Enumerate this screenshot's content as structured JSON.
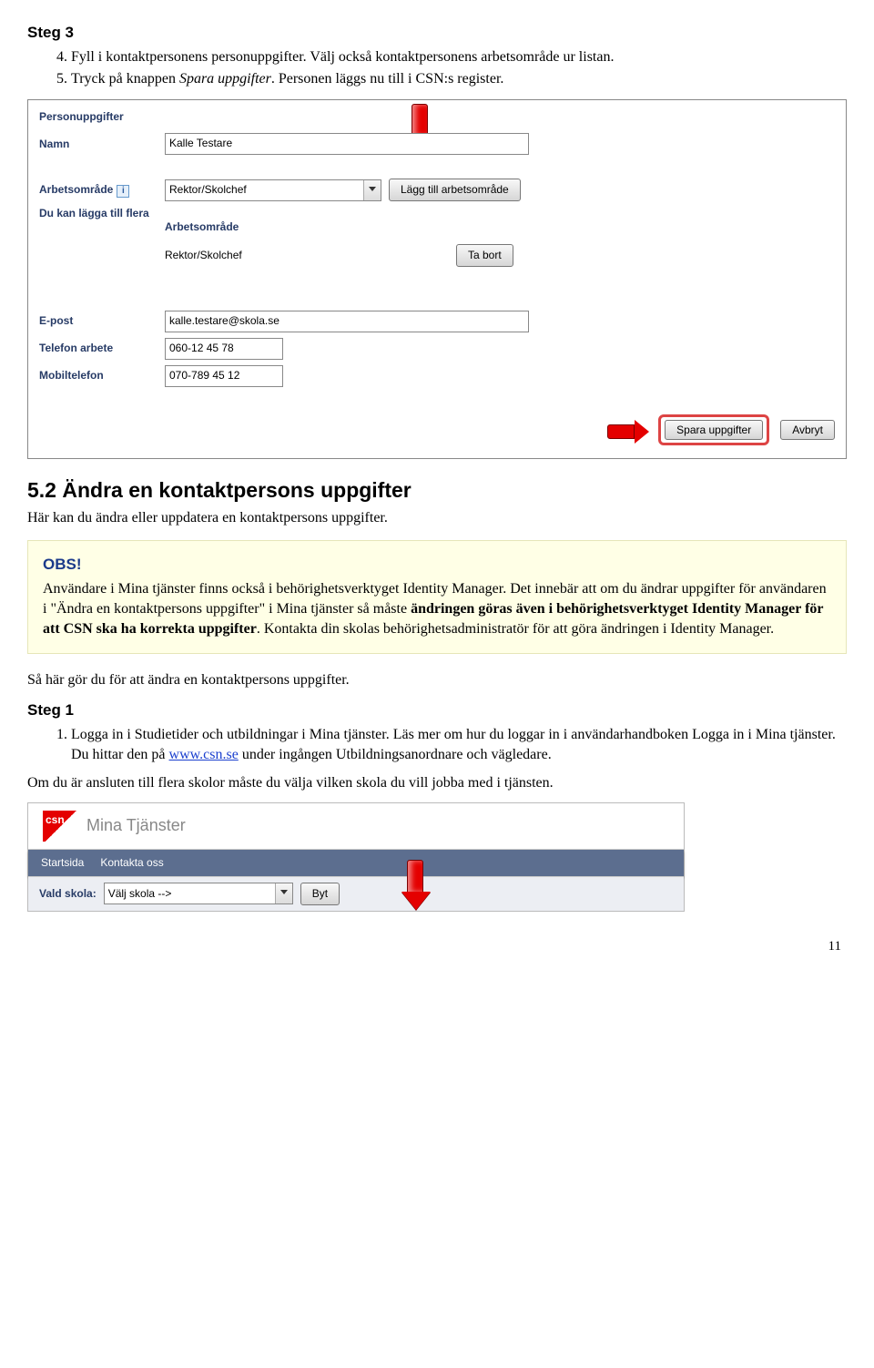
{
  "step3": {
    "title": "Steg 3",
    "items": [
      "Fyll i kontaktpersonens personuppgifter. Välj också kontaktpersonens arbetsområde ur listan.",
      "Tryck på knappen Spara uppgifter. Personen läggs nu till i CSN:s register."
    ],
    "items_italics": [
      "",
      "Spara uppgifter"
    ]
  },
  "form": {
    "legend": "Personuppgifter",
    "labels": {
      "namn": "Namn",
      "arbetsomrade": "Arbetsområde",
      "flera": "Du kan lägga till flera",
      "epost": "E-post",
      "tel_arbete": "Telefon arbete",
      "mobil": "Mobiltelefon"
    },
    "values": {
      "namn": "Kalle Testare",
      "arbetsomrade_select": "Rektor/Skolchef",
      "epost": "kalle.testare@skola.se",
      "tel_arbete": "060-12 45 78",
      "mobil": "070-789 45 12"
    },
    "buttons": {
      "add": "Lägg till arbetsområde",
      "remove": "Ta bort",
      "save": "Spara uppgifter",
      "cancel": "Avbryt"
    },
    "subtable": {
      "header": "Arbetsområde",
      "row": "Rektor/Skolchef"
    }
  },
  "section52": {
    "heading": "5.2 Ändra en kontaktpersons uppgifter",
    "intro": "Här kan du ändra eller uppdatera en kontaktpersons uppgifter."
  },
  "callout": {
    "title": "OBS!",
    "body_parts": [
      "Användare i Mina tjänster finns också i behörighetsverktyget Identity Manager. Det innebär att om du ändrar uppgifter för användaren i \"Ändra en kontaktpersons uppgifter\" i Mina tjänster så måste ",
      "ändringen göras även i behörighetsverktyget Identity Manager för att CSN ska ha korrekta uppgifter",
      ". Kontakta din skolas behörighetsadministratör för att göra ändringen i Identity Manager."
    ]
  },
  "instr_p": "Så här gör du för att ändra en kontaktpersons uppgifter.",
  "step1": {
    "title": "Steg 1",
    "item1_pre": "Logga in i Studietider och utbildningar i Mina tjänster. Läs mer om hur du loggar in i användarhandboken Logga in i Mina tjänster. Du hittar den på ",
    "link": "www.csn.se",
    "item1_post": " under ingången Utbildningsanordnare och vägledare.",
    "after": "Om du är ansluten till flera skolor måste du välja vilken skola du vill jobba med i tjänsten."
  },
  "csn": {
    "title": "Mina Tjänster",
    "logo_text": "csn",
    "nav": [
      "Startsida",
      "Kontakta oss"
    ],
    "bar_label": "Vald skola:",
    "select_value": "Välj skola -->",
    "btn": "Byt"
  },
  "page": "11"
}
